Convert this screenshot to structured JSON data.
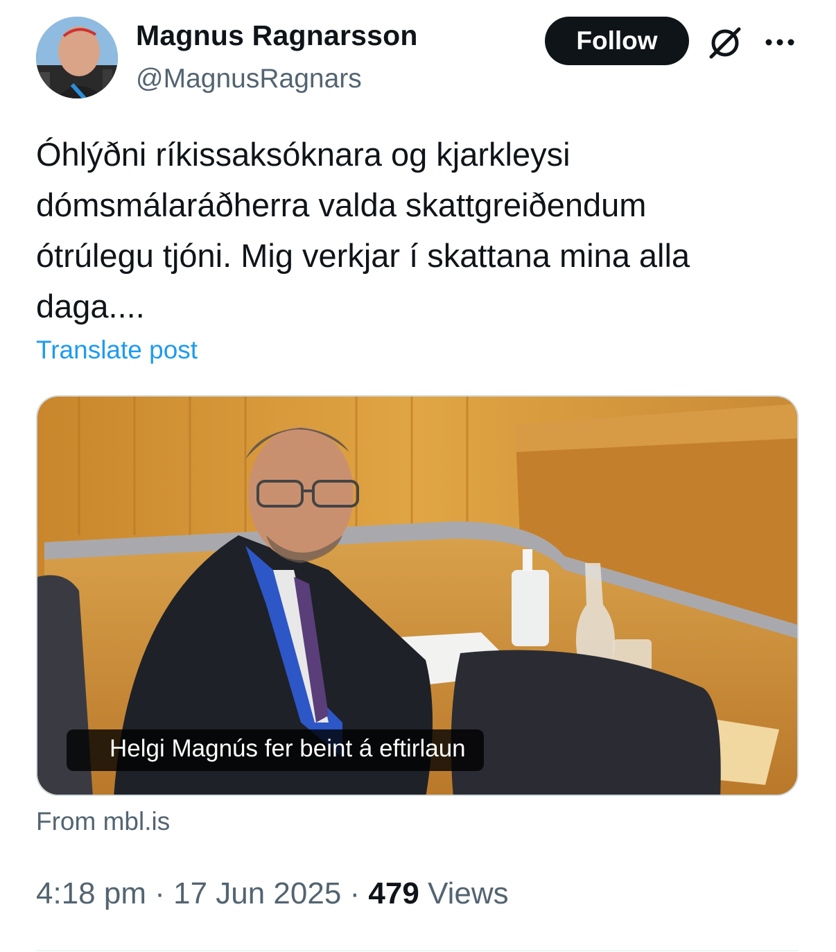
{
  "author": {
    "display_name": "Magnus Ragnarsson",
    "handle": "@MagnusRagnars"
  },
  "actions": {
    "follow_label": "Follow",
    "grok_icon": "grok-slash-circle-icon",
    "more_icon": "more-horizontal-icon"
  },
  "post": {
    "text": "Óhlýðni ríkissaksóknara og kjarkleysi\ndómsmálaráðherra valda skattgreiðendum\nótrúlegu tjóni. Mig verkjar í skattana mina alla\ndaga....",
    "translate_label": "Translate post"
  },
  "link_card": {
    "caption": "Helgi Magnús fer beint á eftirlaun",
    "source": "From mbl.is"
  },
  "meta": {
    "time": "4:18 pm",
    "separator1": " · ",
    "date": "17 Jun 2025",
    "separator2": " · ",
    "views_count": "479",
    "views_label": " Views"
  },
  "colors": {
    "accent_link": "#1d9bf0",
    "text_primary": "#0f1419",
    "text_secondary": "#536471",
    "follow_bg": "#0f1419"
  }
}
